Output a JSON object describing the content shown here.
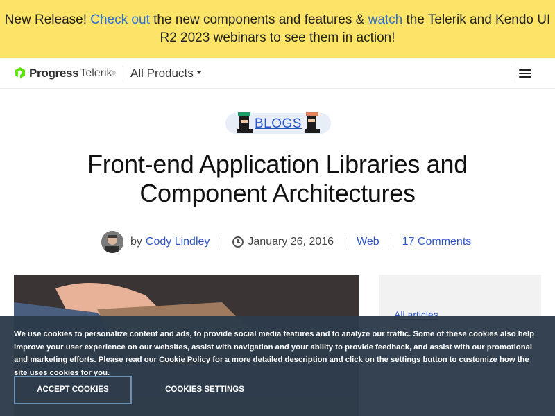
{
  "banner": {
    "part1": "New Release! ",
    "link1": "Check out",
    "part2": " the new components and features & ",
    "link2": "watch",
    "part3": " the Telerik and Kendo UI R2 2023 webinars to see them in action!"
  },
  "nav": {
    "logo_progress": "Progress",
    "logo_telerik": "Telerik",
    "all_products": "All Products"
  },
  "blogs_label": "BLOGS",
  "article": {
    "title": "Front-end Application Libraries and Component Architectures",
    "by": "by",
    "author": "Cody Lindley",
    "date": "January 26, 2016",
    "category": "Web",
    "comments": "17 Comments"
  },
  "sidebar": {
    "all_articles": "All articles"
  },
  "cookie": {
    "text_before": "We use cookies to personalize content and ads, to provide social media features and to analyze our traffic. Some of these cookies also help improve your user experience on our websites, assist with navigation and your ability to provide feedback, and assist with our promotional and marketing efforts. Please read our ",
    "policy_link": "Cookie Policy",
    "text_after": " for a more detailed description and click on the settings button to customize how the site uses cookies for you.",
    "accept": "ACCEPT COOKIES",
    "settings": "COOKIES SETTINGS"
  },
  "colors": {
    "banner_bg": "#fbe468",
    "link": "#2b55c8",
    "cookie_bg": "#2c3a4a",
    "logo_green": "#5ce500"
  }
}
